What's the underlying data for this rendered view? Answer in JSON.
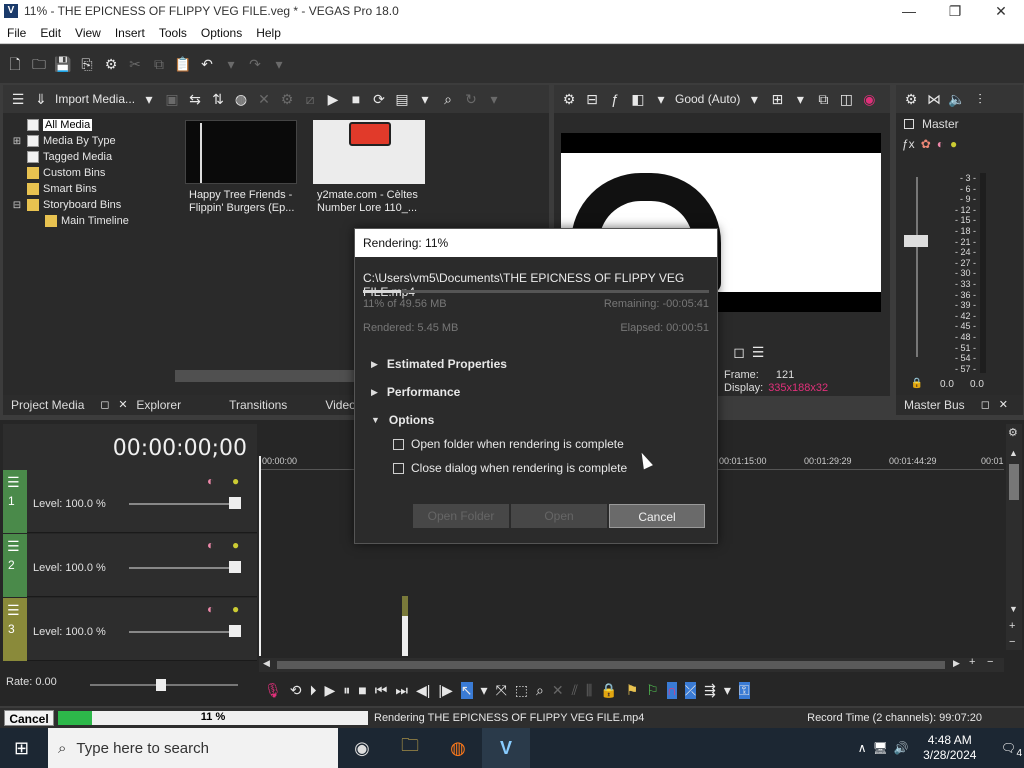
{
  "window": {
    "title": "11% - THE EPICNESS OF FLIPPY VEG FILE.veg * - VEGAS Pro 18.0",
    "app_icon": "V",
    "minimize": "—",
    "maximize": "❐",
    "close": "✕"
  },
  "menu": [
    "File",
    "Edit",
    "View",
    "Insert",
    "Tools",
    "Options",
    "Help"
  ],
  "media_panel": {
    "import_label": "Import Media...",
    "tree": [
      {
        "label": "All Media",
        "selected": true
      },
      {
        "label": "Media By Type"
      },
      {
        "label": "Tagged Media"
      },
      {
        "label": "Custom Bins"
      },
      {
        "label": "Smart Bins"
      },
      {
        "label": "Storyboard Bins"
      },
      {
        "label": "Main Timeline"
      }
    ],
    "thumbs": [
      {
        "caption1": "Happy Tree Friends -",
        "caption2": "Flippin' Burgers (Ep..."
      },
      {
        "caption1": "y2mate.com - Cèltes",
        "caption2": "Number Lore 110_..."
      }
    ],
    "tabs": [
      "Project Media",
      "Explorer",
      "Transitions",
      "Video F"
    ]
  },
  "preview": {
    "quality": "Good (Auto)",
    "frame_label": "Frame:",
    "frame_value": "121",
    "display_label": "Display:",
    "display_value": "335x188x32"
  },
  "master_bus": {
    "title": "Master",
    "tab": "Master Bus",
    "scale": [
      "3",
      "6",
      "9",
      "12",
      "15",
      "18",
      "21",
      "24",
      "27",
      "30",
      "33",
      "36",
      "39",
      "42",
      "45",
      "48",
      "51",
      "54",
      "57"
    ],
    "left_value": "0.0",
    "right_value": "0.0"
  },
  "timeline": {
    "timecode": "00:00:00;00",
    "ruler": [
      "00:00:00",
      "00:01:15:00",
      "00:01:29:29",
      "00:01:44:29",
      "00:01"
    ],
    "tracks": [
      {
        "num": "1",
        "level": "Level: 100.0 %"
      },
      {
        "num": "2",
        "level": "Level: 100.0 %"
      },
      {
        "num": "3",
        "level": "Level: 100.0 %"
      }
    ],
    "rate": "Rate: 0.00"
  },
  "dialog": {
    "title": "Rendering: 11%",
    "path": "C:\\Users\\vm5\\Documents\\THE EPICNESS OF FLIPPY VEG FILE.mp4",
    "progress": 0.11,
    "done": "11% of 49.56 MB",
    "remaining": "Remaining: -00:05:41",
    "rendered": "Rendered: 5.45 MB",
    "elapsed": "Elapsed: 00:00:51",
    "sections": [
      "Estimated Properties",
      "Performance",
      "Options"
    ],
    "checks": [
      "Open folder when rendering is complete",
      "Close dialog when rendering is complete"
    ],
    "buttons": {
      "open_folder": "Open Folder",
      "open": "Open",
      "cancel": "Cancel"
    }
  },
  "status": {
    "cancel": "Cancel",
    "percent": "11 %",
    "message": "Rendering THE EPICNESS OF FLIPPY VEG FILE.mp4",
    "record_time": "Record Time (2 channels): 99:07:20"
  },
  "taskbar": {
    "search_placeholder": "Type here to search",
    "time": "4:48 AM",
    "date": "3/28/2024",
    "notifications": "4"
  },
  "colors": {
    "accent_green": "#2db84a",
    "track_green": "#4a8a4a",
    "track_yellow": "#8a8a3a"
  }
}
